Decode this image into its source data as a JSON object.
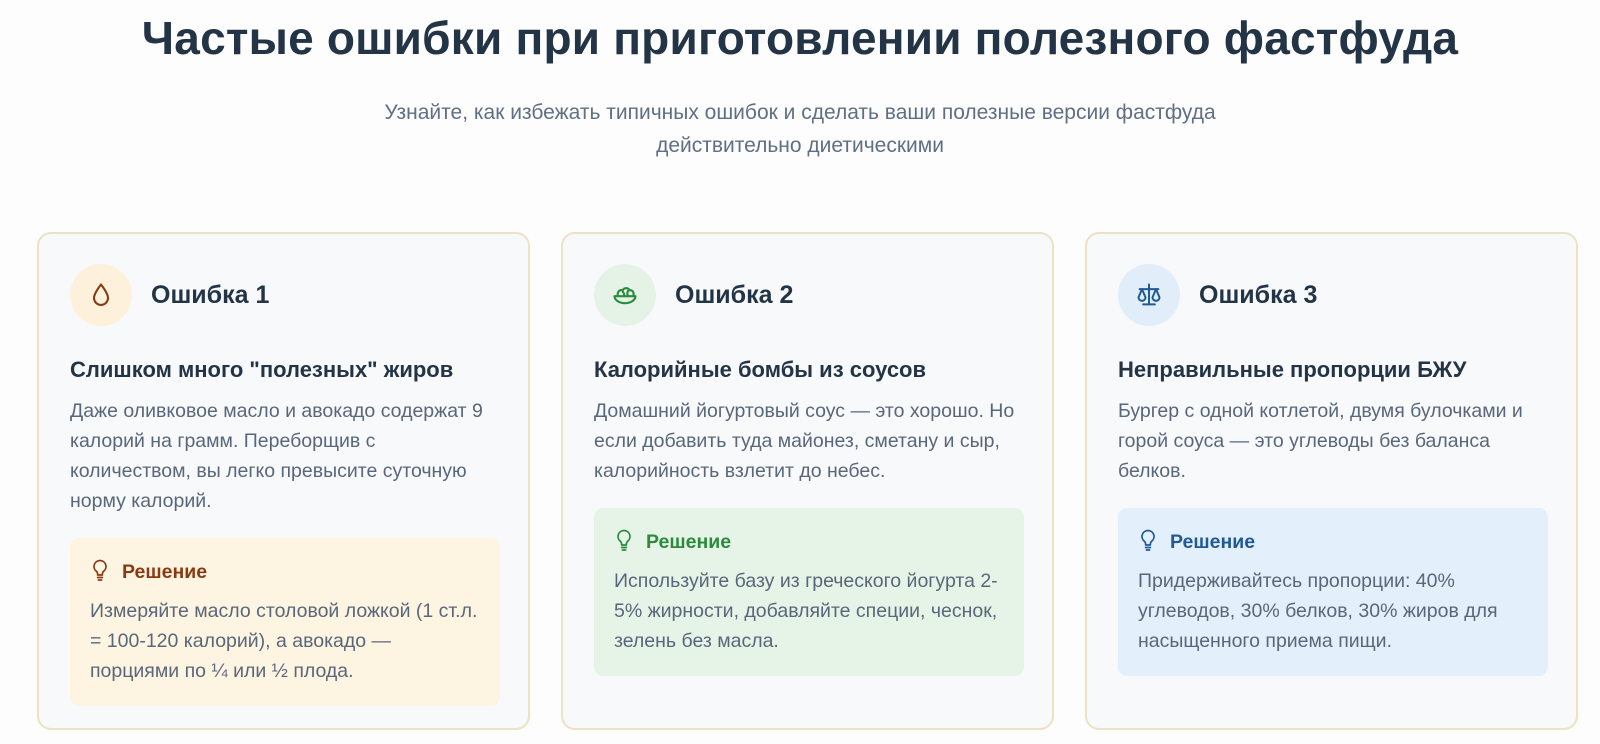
{
  "header": {
    "title": "Частые ошибки при приготовлении полезного фастфуда",
    "subtitle": "Узнайте, как избежать типичных ошибок и сделать ваши полезные версии фастфуда действительно диетическими"
  },
  "cards": [
    {
      "icon": "oil-drop-icon",
      "icon_bg": "#fdf1dc",
      "icon_color": "#8a3a12",
      "label": "Ошибка 1",
      "heading": "Слишком много \"полезных\" жиров",
      "text": "Даже оливковое масло и авокадо содержат 9 калорий на грамм. Переборщив с количеством, вы легко превысите суточную норму калорий.",
      "solution": {
        "title": "Решение",
        "text": "Измеряйте масло столовой ложкой (1 ст.л. = 100-120 калорий), а авокадо — порциями по ¼ или ½ плода.",
        "bg": "#fdf4e2",
        "color": "#8a3a12"
      }
    },
    {
      "icon": "salad-bowl-icon",
      "icon_bg": "#e5f3e7",
      "icon_color": "#2b8a3e",
      "label": "Ошибка 2",
      "heading": "Калорийные бомбы из соусов",
      "text": "Домашний йогуртовый соус — это хорошо. Но если добавить туда майонез, сметану и сыр, калорийность взлетит до небес.",
      "solution": {
        "title": "Решение",
        "text": "Используйте базу из греческого йогурта 2-5% жирности, добавляйте специи, чеснок, зелень без масла.",
        "bg": "#e6f3e7",
        "color": "#2b8a3e"
      }
    },
    {
      "icon": "balance-scale-icon",
      "icon_bg": "#e1edf8",
      "icon_color": "#1f5a96",
      "label": "Ошибка 3",
      "heading": "Неправильные пропорции БЖУ",
      "text": "Бургер с одной котлетой, двумя булочками и горой соуса — это углеводы без баланса белков.",
      "solution": {
        "title": "Решение",
        "text": "Придерживайтесь пропорции: 40% углеводов, 30% белков, 30% жиров для насыщенного приема пищи.",
        "bg": "#e3effa",
        "color": "#1f5a96"
      }
    }
  ]
}
